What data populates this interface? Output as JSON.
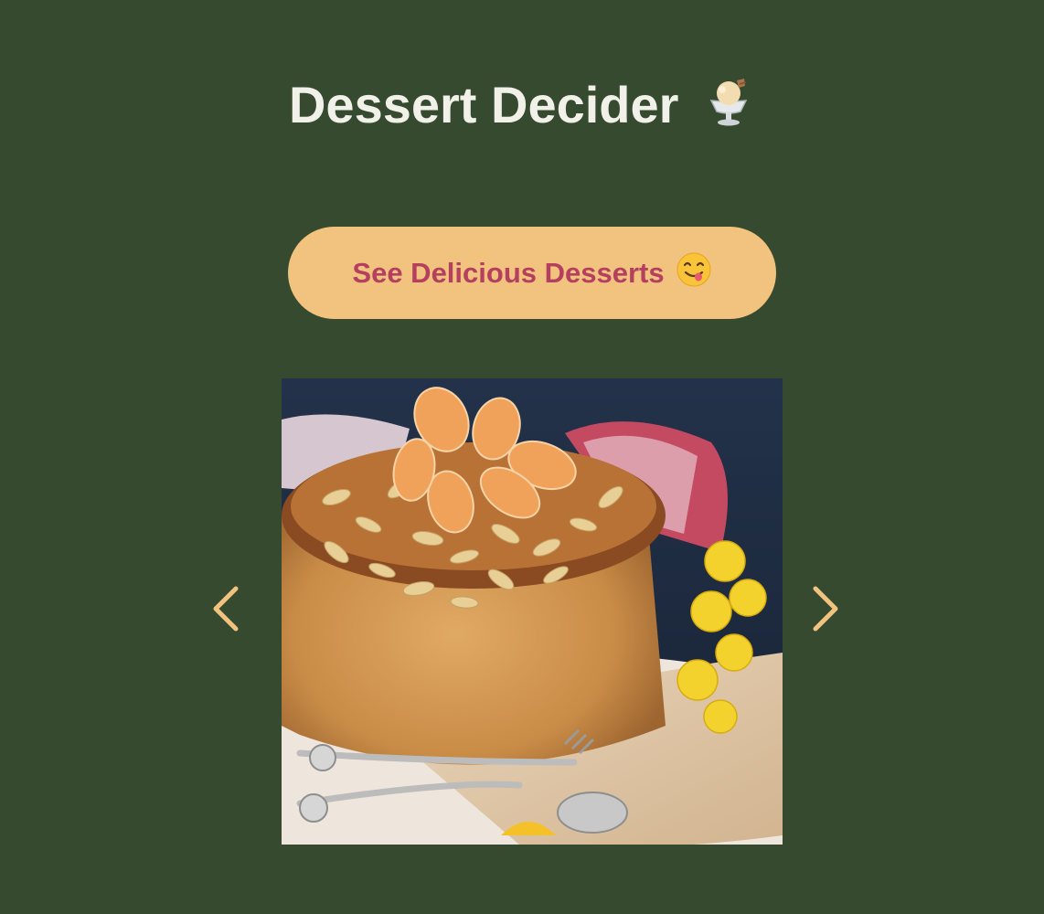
{
  "page": {
    "title": "Dessert Decider",
    "title_icon": "ice-cream-sundae-icon"
  },
  "cta_button": {
    "label": "See Delicious Desserts",
    "icon": "yum-face-emoji-icon"
  },
  "carousel": {
    "prev_icon": "chevron-left-icon",
    "next_icon": "chevron-right-icon",
    "current_image": "orange-almond-cake-photo"
  },
  "colors": {
    "background": "#364a2f",
    "accent": "#f2c27f",
    "button_text": "#b43f5e",
    "title_text": "#f1f1ea"
  }
}
